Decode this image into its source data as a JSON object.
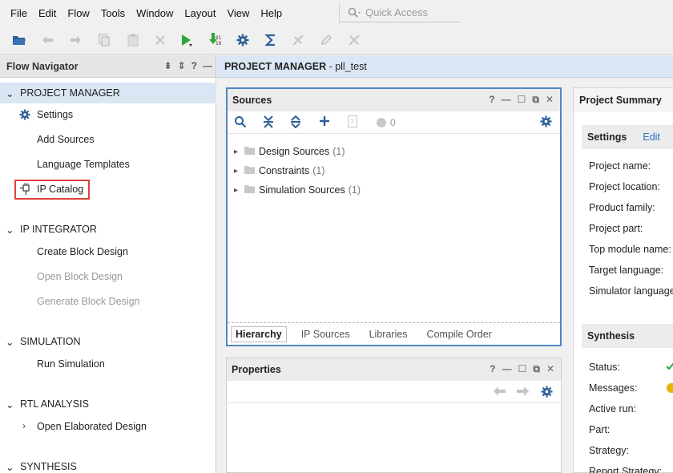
{
  "menu": [
    "File",
    "Edit",
    "Flow",
    "Tools",
    "Window",
    "Layout",
    "View",
    "Help"
  ],
  "quick_access": {
    "placeholder": "Quick Access"
  },
  "flow_navigator": {
    "title": "Flow Navigator",
    "sections": [
      {
        "label": "PROJECT MANAGER",
        "items": [
          {
            "label": "Settings",
            "icon": "gear-icon"
          },
          {
            "label": "Add Sources"
          },
          {
            "label": "Language Templates"
          },
          {
            "label": "IP Catalog",
            "icon": "plug-icon",
            "highlighted": true
          }
        ]
      },
      {
        "label": "IP INTEGRATOR",
        "items": [
          {
            "label": "Create Block Design"
          },
          {
            "label": "Open Block Design",
            "disabled": true
          },
          {
            "label": "Generate Block Design",
            "disabled": true
          }
        ]
      },
      {
        "label": "SIMULATION",
        "items": [
          {
            "label": "Run Simulation"
          }
        ]
      },
      {
        "label": "RTL ANALYSIS",
        "items": [
          {
            "label": "Open Elaborated Design"
          }
        ]
      },
      {
        "label": "SYNTHESIS",
        "items": []
      }
    ]
  },
  "project_bar": {
    "title": "PROJECT MANAGER",
    "suffix": " - pll_test"
  },
  "sources": {
    "title": "Sources",
    "msg_count": "0",
    "tree": [
      {
        "label": "Design Sources",
        "count": "(1)"
      },
      {
        "label": "Constraints",
        "count": "(1)"
      },
      {
        "label": "Simulation Sources",
        "count": "(1)"
      }
    ],
    "tabs": [
      "Hierarchy",
      "IP Sources",
      "Libraries",
      "Compile Order"
    ]
  },
  "properties": {
    "title": "Properties"
  },
  "summary": {
    "title": "Project Summary",
    "settings": {
      "label": "Settings",
      "edit": "Edit",
      "rows": [
        "Project name:",
        "Project location:",
        "Product family:",
        "Project part:",
        "Top module name:",
        "Target language:",
        "Simulator language"
      ]
    },
    "synthesis": {
      "label": "Synthesis",
      "rows": [
        "Status:",
        "Messages:",
        "Active run:",
        "Part:",
        "Strategy:",
        "Report Strategy:"
      ]
    }
  },
  "colors": {
    "accent": "#4f86c6",
    "highlight": "#e0403a",
    "active_section": "#dbe6f4"
  }
}
